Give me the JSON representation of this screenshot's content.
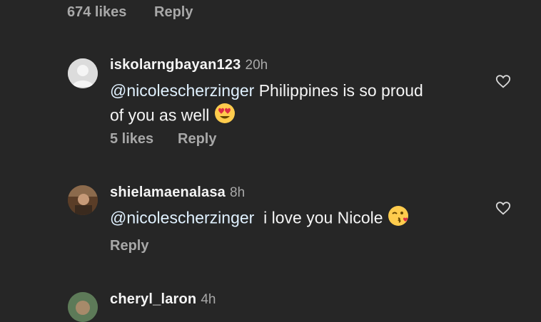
{
  "top_comment": {
    "likes": "674 likes",
    "reply": "Reply"
  },
  "comments": [
    {
      "username": "iskolarngbayan123",
      "time": "20h",
      "mention": "@nicolescherzinger",
      "text_line1": "Philippines is so proud",
      "text_line2": "of you as well",
      "emoji": "heart-eyes-emoji",
      "likes": "5 likes",
      "reply": "Reply",
      "avatar": "default-avatar"
    },
    {
      "username": "shielamaenalasa",
      "time": "8h",
      "mention": "@nicolescherzinger",
      "text": "i love you Nicole",
      "emoji": "kissing-face-emoji",
      "reply": "Reply",
      "avatar": "photo-avatar"
    },
    {
      "username": "cheryl_laron",
      "time": "4h",
      "avatar": "photo-avatar"
    }
  ]
}
